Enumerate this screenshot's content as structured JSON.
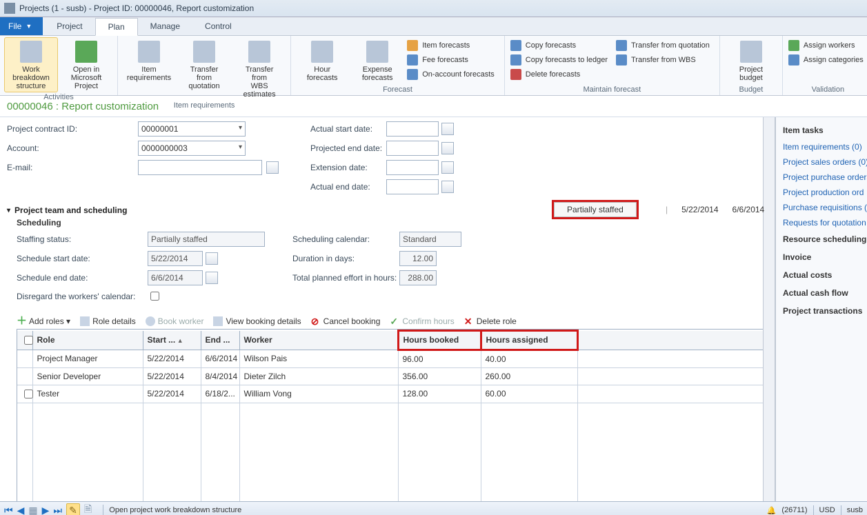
{
  "window": {
    "title": "Projects (1 - susb) - Project ID: 00000046, Report customization"
  },
  "tabs": {
    "file": "File",
    "items": [
      "Project",
      "Plan",
      "Manage",
      "Control"
    ],
    "activeIndex": 1
  },
  "ribbon": {
    "activities": {
      "label": "Activities",
      "wbs": {
        "l1": "Work breakdown",
        "l2": "structure"
      },
      "msp": {
        "l1": "Open in Microsoft",
        "l2": "Project"
      }
    },
    "itemreq": {
      "label": "Item requirements",
      "ir": {
        "l1": "Item",
        "l2": "requirements"
      },
      "tq": {
        "l1": "Transfer from",
        "l2": "quotation"
      },
      "tw": {
        "l1": "Transfer from",
        "l2": "WBS estimates"
      }
    },
    "forecast": {
      "label": "Forecast",
      "hf": {
        "l1": "Hour",
        "l2": "forecasts"
      },
      "ef": {
        "l1": "Expense",
        "l2": "forecasts"
      },
      "itemf": "Item forecasts",
      "feef": "Fee forecasts",
      "oaf": "On-account forecasts"
    },
    "maintain": {
      "label": "Maintain forecast",
      "copy": "Copy forecasts",
      "copyledger": "Copy forecasts to ledger",
      "delete": "Delete forecasts",
      "tfq": "Transfer from quotation",
      "tfw": "Transfer from WBS"
    },
    "budget": {
      "label": "Budget",
      "pb": {
        "l1": "Project",
        "l2": "budget"
      }
    },
    "validation": {
      "label": "Validation",
      "aw": "Assign workers",
      "ac": "Assign categories"
    }
  },
  "breadcrumb": "00000046 : Report customization",
  "form": {
    "contract_label": "Project contract ID:",
    "contract_value": "00000001",
    "account_label": "Account:",
    "account_value": "0000000003",
    "email_label": "E-mail:",
    "email_value": "",
    "astart_label": "Actual start date:",
    "pend_label": "Projected end date:",
    "ext_label": "Extension date:",
    "aend_label": "Actual end date:"
  },
  "section": {
    "title": "Project team and scheduling",
    "sub": "Scheduling",
    "staffing_label": "Staffing status:",
    "staffing_value": "Partially staffed",
    "schedstart_label": "Schedule start date:",
    "schedstart_value": "5/22/2014",
    "schedend_label": "Schedule end date:",
    "schedend_value": "6/6/2014",
    "disregard_label": "Disregard the workers' calendar:",
    "schedcal_label": "Scheduling calendar:",
    "schedcal_value": "Standard",
    "durdays_label": "Duration in days:",
    "durdays_value": "12.00",
    "tph_label": "Total planned effort in hours:",
    "tph_value": "288.00",
    "badge": "Partially staffed",
    "date1": "5/22/2014",
    "date2": "6/6/2014"
  },
  "toolbar2": {
    "addroles": "Add roles ▾",
    "roledetails": "Role details",
    "bookworker": "Book worker",
    "viewbooking": "View booking details",
    "cancelbooking": "Cancel booking",
    "confirmhours": "Confirm hours",
    "deleterole": "Delete role"
  },
  "grid": {
    "columns": {
      "role": "Role",
      "start": "Start ...",
      "end": "End ...",
      "worker": "Worker",
      "hbooked": "Hours booked",
      "hassigned": "Hours assigned"
    },
    "rows": [
      {
        "role": "Project Manager",
        "start": "5/22/2014",
        "end": "6/6/2014",
        "worker": "Wilson Pais",
        "hb": "96.00",
        "ha": "40.00"
      },
      {
        "role": "Senior Developer",
        "start": "5/22/2014",
        "end": "8/4/2014",
        "worker": "Dieter Zilch",
        "hb": "356.00",
        "ha": "260.00"
      },
      {
        "role": "Tester",
        "start": "5/22/2014",
        "end": "6/18/2...",
        "worker": "William Vong",
        "hb": "128.00",
        "ha": "60.00"
      }
    ]
  },
  "sidepanel": {
    "head": "Item tasks",
    "links": [
      "Item requirements (0)",
      "Project sales orders (0)",
      "Project purchase orders",
      "Project production ord",
      "Purchase requisitions (",
      "Requests for quotation"
    ],
    "items": [
      "Resource scheduling",
      "Invoice",
      "Actual costs",
      "Actual cash flow",
      "Project transactions"
    ]
  },
  "statusbar": {
    "text": "Open project work breakdown structure",
    "alerts": "(26711)",
    "currency": "USD",
    "user": "susb"
  }
}
